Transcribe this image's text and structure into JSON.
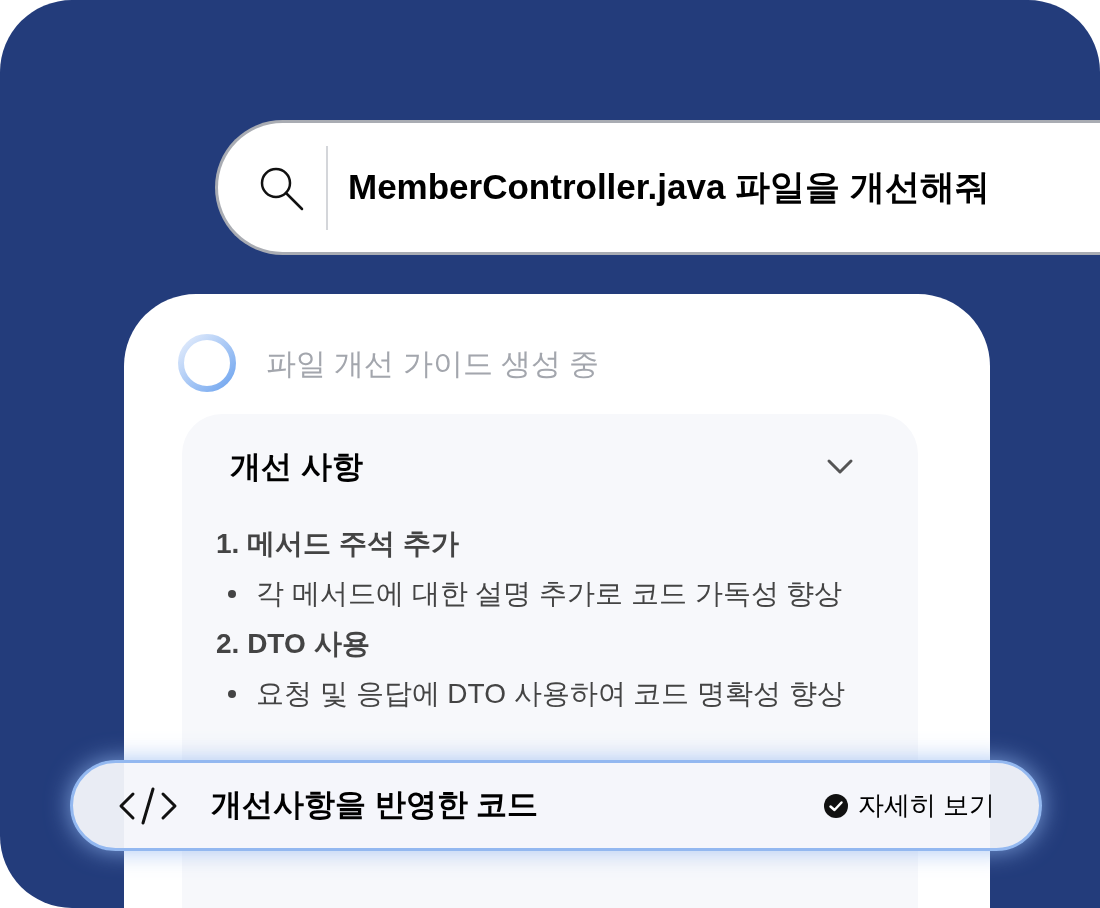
{
  "search": {
    "query": "MemberController.java 파일을 개선해줘"
  },
  "status": {
    "text": "파일 개선 가이드 생성 중",
    "loading": true
  },
  "panel": {
    "title": "개선 사항",
    "expanded": true,
    "items": [
      {
        "heading": "1. 메서드 주석 추가",
        "bullets": [
          "각 메서드에 대한 설명 추가로 코드 가독성 향상"
        ]
      },
      {
        "heading": "2. DTO 사용",
        "bullets": [
          "요청 및 응답에 DTO 사용하여 코드 명확성 향상"
        ]
      }
    ]
  },
  "result_bar": {
    "title": "개선사항을 반영한 코드",
    "action": "자세히 보기"
  }
}
